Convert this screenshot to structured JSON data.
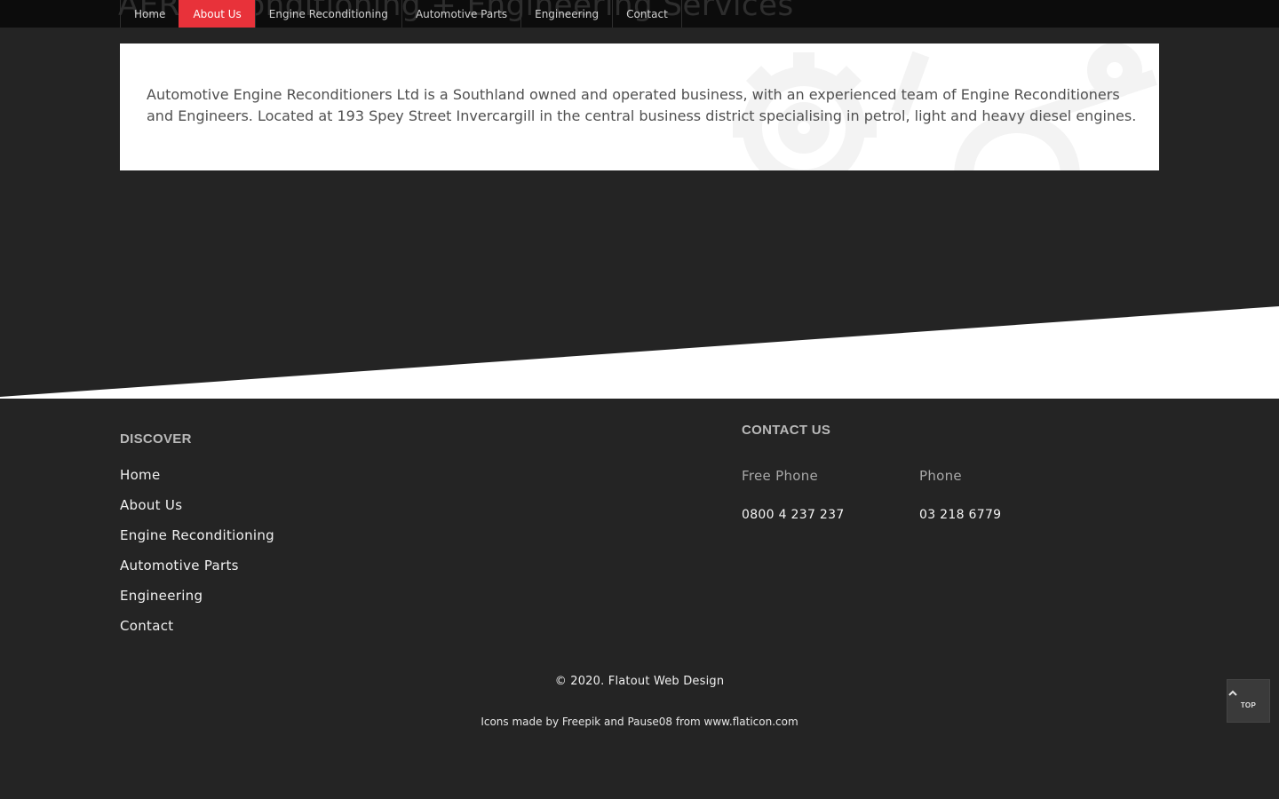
{
  "header": {
    "site_title": "AER Reconditioning + Engineering Services",
    "nav": [
      {
        "label": "Home"
      },
      {
        "label": "About Us",
        "active": true
      },
      {
        "label": "Engine Reconditioning"
      },
      {
        "label": "Automotive Parts"
      },
      {
        "label": "Engineering"
      },
      {
        "label": "Contact"
      }
    ],
    "active_color": "#e8323a"
  },
  "intro": {
    "text": "Automotive Engine Reconditioners Ltd is a Southland owned and operated business, with an experienced team of Engine Reconditioners and Engineers. Located at 193 Spey Street Invercargill in the central business district specialising in petrol, light and heavy diesel engines.",
    "watermark_icon": "gears-icon"
  },
  "footer": {
    "discover": {
      "heading": "DISCOVER",
      "links": [
        {
          "label": "Home"
        },
        {
          "label": "About Us"
        },
        {
          "label": "Engine Reconditioning"
        },
        {
          "label": "Automotive Parts"
        },
        {
          "label": "Engineering"
        },
        {
          "label": "Contact"
        }
      ]
    },
    "contact": {
      "heading": "CONTACT US",
      "free_phone_label": "Free Phone",
      "free_phone_value": "0800 4 237 237",
      "phone_label": "Phone",
      "phone_value": "03 218 6779"
    },
    "copyright": "© 2020. Flatout Web Design",
    "credits": "Icons made by Freepik and Pause08 from www.flaticon.com"
  },
  "back_to_top": {
    "label": "TOP",
    "icon": "chevron-up-icon"
  }
}
